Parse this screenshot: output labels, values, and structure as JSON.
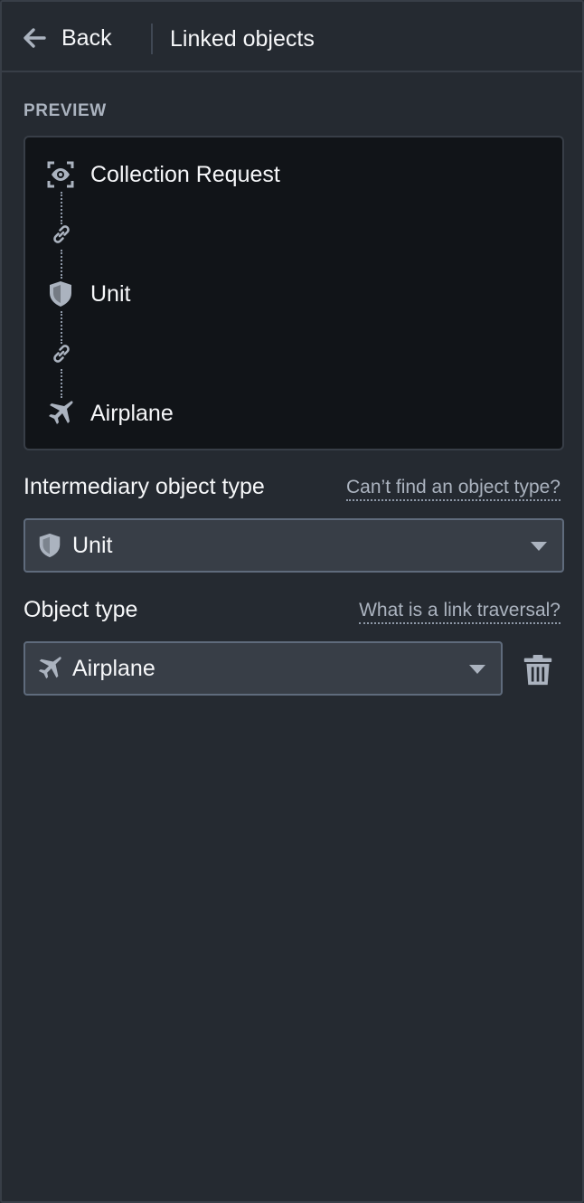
{
  "header": {
    "back_label": "Back",
    "title": "Linked objects"
  },
  "preview": {
    "section_label": "PREVIEW",
    "nodes": [
      {
        "label": "Collection Request",
        "icon": "eye-frame-icon"
      },
      {
        "label": "Unit",
        "icon": "shield-icon"
      },
      {
        "label": "Airplane",
        "icon": "airplane-icon"
      }
    ],
    "connector_icon": "link-icon"
  },
  "intermediary": {
    "label": "Intermediary object type",
    "help_link": "Can’t find an object type?",
    "selected": "Unit",
    "icon": "shield-icon"
  },
  "object_type": {
    "label": "Object type",
    "help_link": "What is a link traversal?",
    "selected": "Airplane",
    "icon": "airplane-icon"
  },
  "colors": {
    "background": "#252a31",
    "preview_bg": "#111418",
    "border": "#383e47",
    "text": "#f6f7f9",
    "muted": "#abb3bf"
  }
}
